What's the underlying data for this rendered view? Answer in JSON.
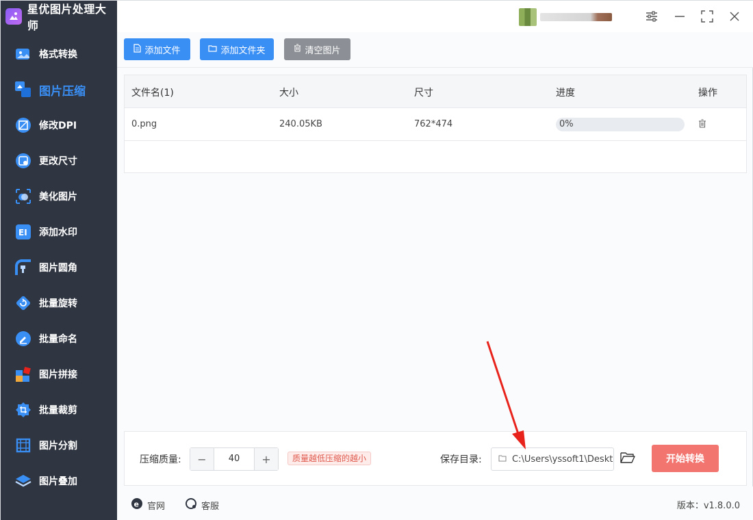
{
  "app": {
    "title": "星优图片处理大师"
  },
  "sidebar": {
    "items": [
      {
        "label": "格式转换",
        "icon": "image-convert-icon",
        "active": false,
        "color": "#3a8ff5"
      },
      {
        "label": "图片压缩",
        "icon": "image-compress-icon",
        "active": true,
        "color": "#3a8ff5"
      },
      {
        "label": "修改DPI",
        "icon": "dpi-icon",
        "active": false,
        "color": "#3a8ff5"
      },
      {
        "label": "更改尺寸",
        "icon": "resize-icon",
        "active": false,
        "color": "#3a8ff5"
      },
      {
        "label": "美化图片",
        "icon": "beautify-icon",
        "active": false,
        "color": "#3a8ff5"
      },
      {
        "label": "添加水印",
        "icon": "watermark-icon",
        "active": false,
        "color": "#3a8ff5"
      },
      {
        "label": "图片圆角",
        "icon": "rounded-corner-icon",
        "active": false,
        "color": "#3a8ff5"
      },
      {
        "label": "批量旋转",
        "icon": "rotate-icon",
        "active": false,
        "color": "#3a8ff5"
      },
      {
        "label": "批量命名",
        "icon": "rename-icon",
        "active": false,
        "color": "#3a8ff5"
      },
      {
        "label": "图片拼接",
        "icon": "puzzle-icon",
        "active": false,
        "color": "#3a8ff5"
      },
      {
        "label": "批量裁剪",
        "icon": "crop-icon",
        "active": false,
        "color": "#3a8ff5"
      },
      {
        "label": "图片分割",
        "icon": "split-icon",
        "active": false,
        "color": "#3a8ff5"
      },
      {
        "label": "图片叠加",
        "icon": "layers-icon",
        "active": false,
        "color": "#3a8ff5"
      }
    ]
  },
  "toolbar": {
    "add_file": "添加文件",
    "add_folder": "添加文件夹",
    "clear": "清空图片"
  },
  "table": {
    "headers": [
      "文件名(1)",
      "大小",
      "尺寸",
      "进度",
      "操作"
    ],
    "rows": [
      {
        "name": "0.png",
        "size": "240.05KB",
        "dimensions": "762*474",
        "progress": "0%"
      }
    ]
  },
  "bottom": {
    "quality_label": "压缩质量:",
    "quality_value": "40",
    "minus": "−",
    "plus": "+",
    "hint": "质量越低压缩的越小",
    "save_label": "保存目录:",
    "save_path": "C:\\Users\\yssoft1\\Deskt",
    "start": "开始转换"
  },
  "footer": {
    "website": "官网",
    "support": "客服",
    "version": "版本：v1.8.0.0"
  },
  "colors": {
    "accent": "#3a8ff5",
    "start": "#f27570",
    "sidebar": "#2f3541",
    "arrow": "#e8231c"
  }
}
